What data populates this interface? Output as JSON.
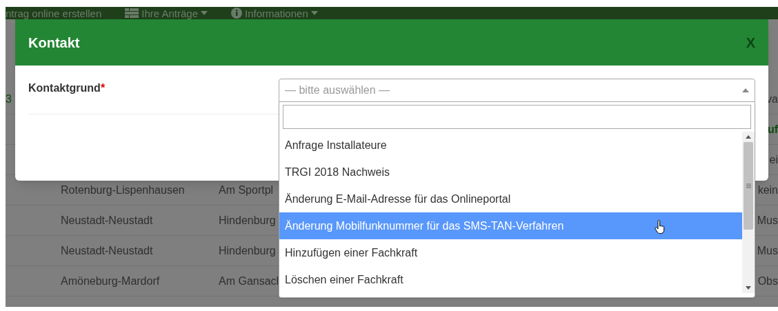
{
  "nav": {
    "items": [
      {
        "label": "ntrag online erstellen"
      },
      {
        "label": "Ihre Anträge"
      },
      {
        "label": "Informationen"
      }
    ]
  },
  "background_table": {
    "rows": [
      {
        "cells": [
          "3",
          "",
          "",
          "va"
        ],
        "kind": "header"
      },
      {
        "cells": [
          "",
          "",
          "",
          "uf"
        ],
        "kind": "highlight"
      },
      {
        "cells": [
          "",
          "",
          "",
          "ei"
        ],
        "kind": "plain"
      },
      {
        "cells": [
          "",
          "Rotenburg-Lispenhausen",
          "Am Sportpl",
          "kein"
        ],
        "kind": "plain"
      },
      {
        "cells": [
          "",
          "Neustadt-Neustadt",
          "Hindenburg",
          "Mus"
        ],
        "kind": "plain"
      },
      {
        "cells": [
          "",
          "Neustadt-Neustadt",
          "Hindenburg",
          "Mus"
        ],
        "kind": "plain"
      },
      {
        "cells": [
          "",
          "Amöneburg-Mardorf",
          "Am Gansacl",
          "Obs"
        ],
        "kind": "plain"
      }
    ]
  },
  "modal": {
    "title": "Kontakt",
    "close": "X",
    "field_label": "Kontaktgrund",
    "required_mark": "*",
    "select": {
      "placeholder": "— bitte auswählen —",
      "expanded": true,
      "options": [
        {
          "label": "Anfrage Installateure",
          "selected": false
        },
        {
          "label": "TRGI 2018 Nachweis",
          "selected": false
        },
        {
          "label": "Änderung E-Mail-Adresse für das Onlineportal",
          "selected": false
        },
        {
          "label": "Änderung Mobilfunknummer für das SMS-TAN-Verfahren",
          "selected": true
        },
        {
          "label": "Hinzufügen einer Fachkraft",
          "selected": false
        },
        {
          "label": "Löschen einer Fachkraft",
          "selected": false
        }
      ]
    }
  }
}
